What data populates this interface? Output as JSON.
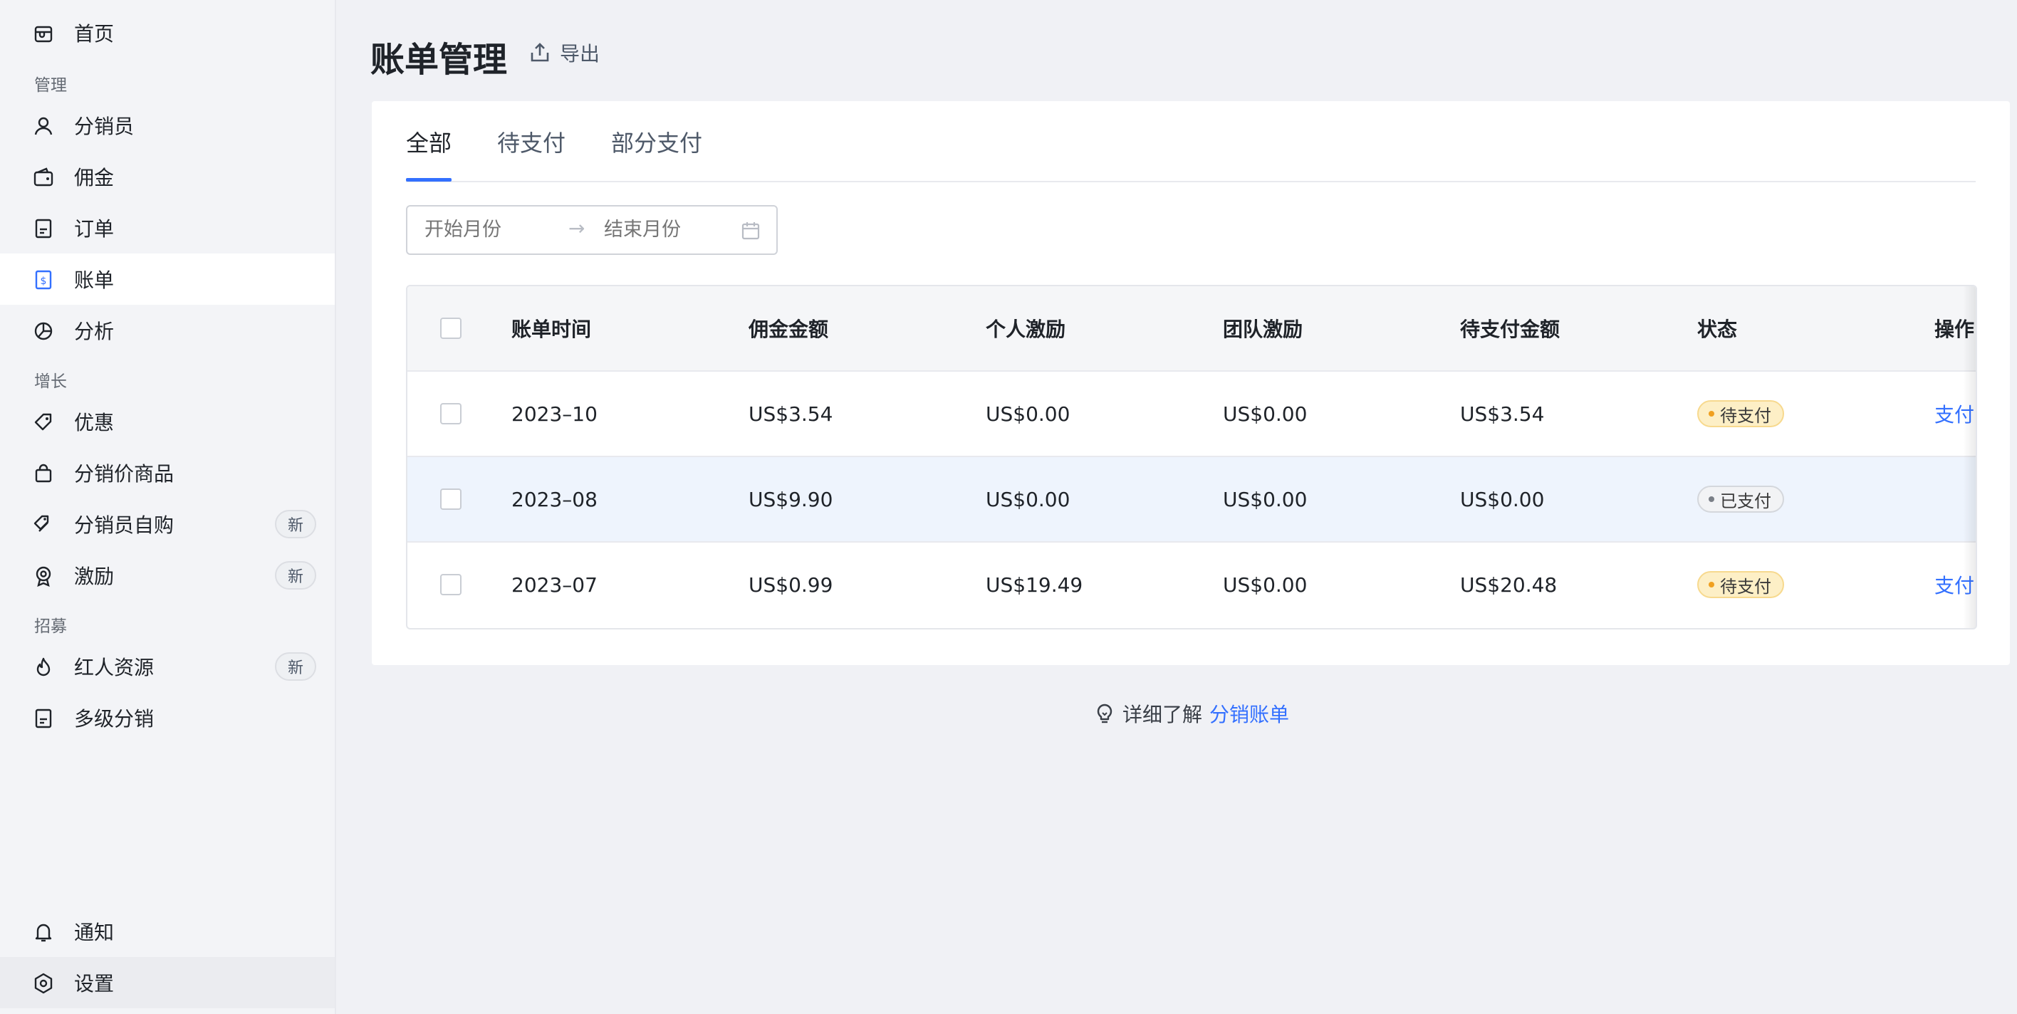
{
  "sidebar": {
    "items": [
      {
        "id": "home",
        "label": "首页",
        "icon": "store-icon",
        "badge": ""
      },
      {
        "id": "distributors",
        "label": "分销员",
        "icon": "user-icon",
        "badge": ""
      },
      {
        "id": "commission",
        "label": "佣金",
        "icon": "wallet-icon",
        "badge": ""
      },
      {
        "id": "orders",
        "label": "订单",
        "icon": "order-icon",
        "badge": ""
      },
      {
        "id": "bills",
        "label": "账单",
        "icon": "bill-icon",
        "badge": ""
      },
      {
        "id": "analytics",
        "label": "分析",
        "icon": "pie-chart-icon",
        "badge": ""
      },
      {
        "id": "discounts",
        "label": "优惠",
        "icon": "tag-icon",
        "badge": ""
      },
      {
        "id": "distribution-products",
        "label": "分销价商品",
        "icon": "bag-icon",
        "badge": ""
      },
      {
        "id": "self-purchase",
        "label": "分销员自购",
        "icon": "tags-icon",
        "badge": "新"
      },
      {
        "id": "incentives",
        "label": "激励",
        "icon": "medal-icon",
        "badge": "新"
      },
      {
        "id": "influencer-resources",
        "label": "红人资源",
        "icon": "fire-icon",
        "badge": "新"
      },
      {
        "id": "multi-level",
        "label": "多级分销",
        "icon": "document-icon",
        "badge": ""
      },
      {
        "id": "notifications",
        "label": "通知",
        "icon": "bell-icon",
        "badge": ""
      },
      {
        "id": "settings",
        "label": "设置",
        "icon": "gear-icon",
        "badge": ""
      }
    ],
    "sections": {
      "manage": "管理",
      "growth": "增长",
      "recruit": "招募"
    },
    "active": "bills"
  },
  "header": {
    "title": "账单管理",
    "export_label": "导出"
  },
  "tabs": [
    {
      "label": "全部",
      "active": true
    },
    {
      "label": "待支付",
      "active": false
    },
    {
      "label": "部分支付",
      "active": false
    }
  ],
  "range_picker": {
    "start_placeholder": "开始月份",
    "end_placeholder": "结束月份",
    "separator": "→"
  },
  "table": {
    "columns": [
      "账单时间",
      "佣金金额",
      "个人激励",
      "团队激励",
      "待支付金额",
      "状态",
      "操作"
    ],
    "rows": [
      {
        "time": "2023–10",
        "commission": "US$3.54",
        "personal": "US$0.00",
        "team": "US$0.00",
        "pending": "US$3.54",
        "status": "待支付",
        "status_type": "pending",
        "action": "支付"
      },
      {
        "time": "2023–08",
        "commission": "US$9.90",
        "personal": "US$0.00",
        "team": "US$0.00",
        "pending": "US$0.00",
        "status": "已支付",
        "status_type": "paid",
        "action": ""
      },
      {
        "time": "2023–07",
        "commission": "US$0.99",
        "personal": "US$19.49",
        "team": "US$0.00",
        "pending": "US$20.48",
        "status": "待支付",
        "status_type": "pending",
        "action": "支付"
      }
    ]
  },
  "footer": {
    "tip_text": "详细了解",
    "tip_link": "分销账单"
  },
  "colors": {
    "accent": "#3370ff",
    "pending_bg": "#fdefc6",
    "paid_bg": "#f2f3f5"
  }
}
